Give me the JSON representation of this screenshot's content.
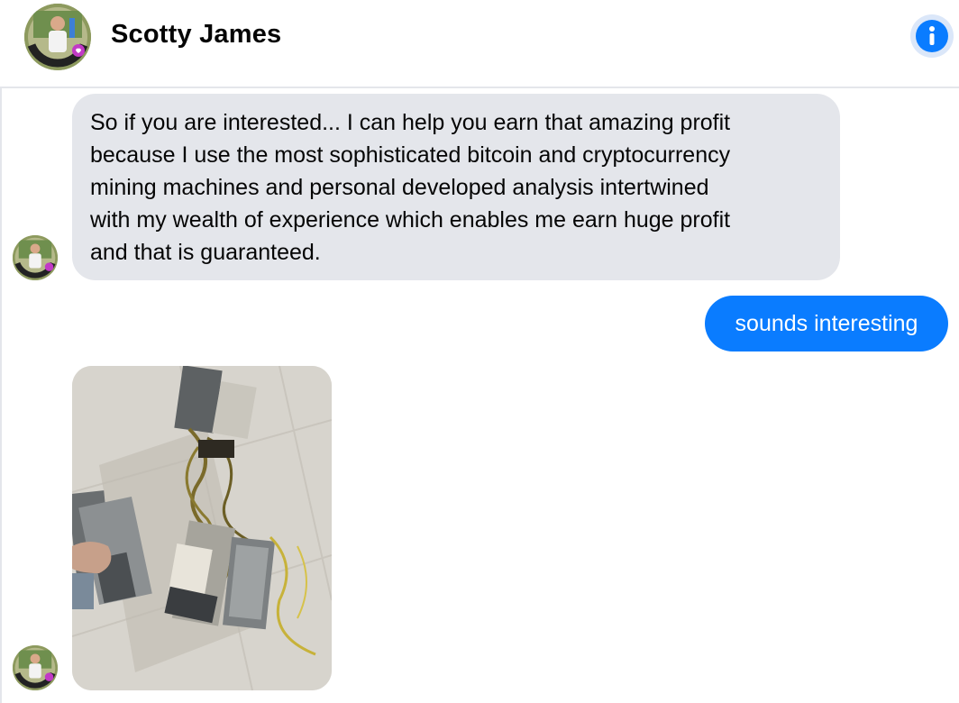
{
  "header": {
    "contact_name": "Scotty James",
    "avatar_icon": "profile-avatar",
    "info_icon": "info-icon"
  },
  "messages": [
    {
      "direction": "incoming",
      "type": "text",
      "text": "So if you are interested... I can help you earn that amazing profit\nbecause I use the most sophisticated bitcoin and cryptocurrency\nmining machines and personal developed analysis intertwined\nwith my wealth of experience which enables me earn huge profit\nand that is guaranteed."
    },
    {
      "direction": "outgoing",
      "type": "text",
      "text": "sounds interesting"
    },
    {
      "direction": "incoming",
      "type": "image",
      "image_icon": "mining-machines-photo"
    }
  ],
  "colors": {
    "accent": "#0a7cff",
    "incoming_bubble": "#e4e6eb",
    "outgoing_text": "#ffffff"
  }
}
